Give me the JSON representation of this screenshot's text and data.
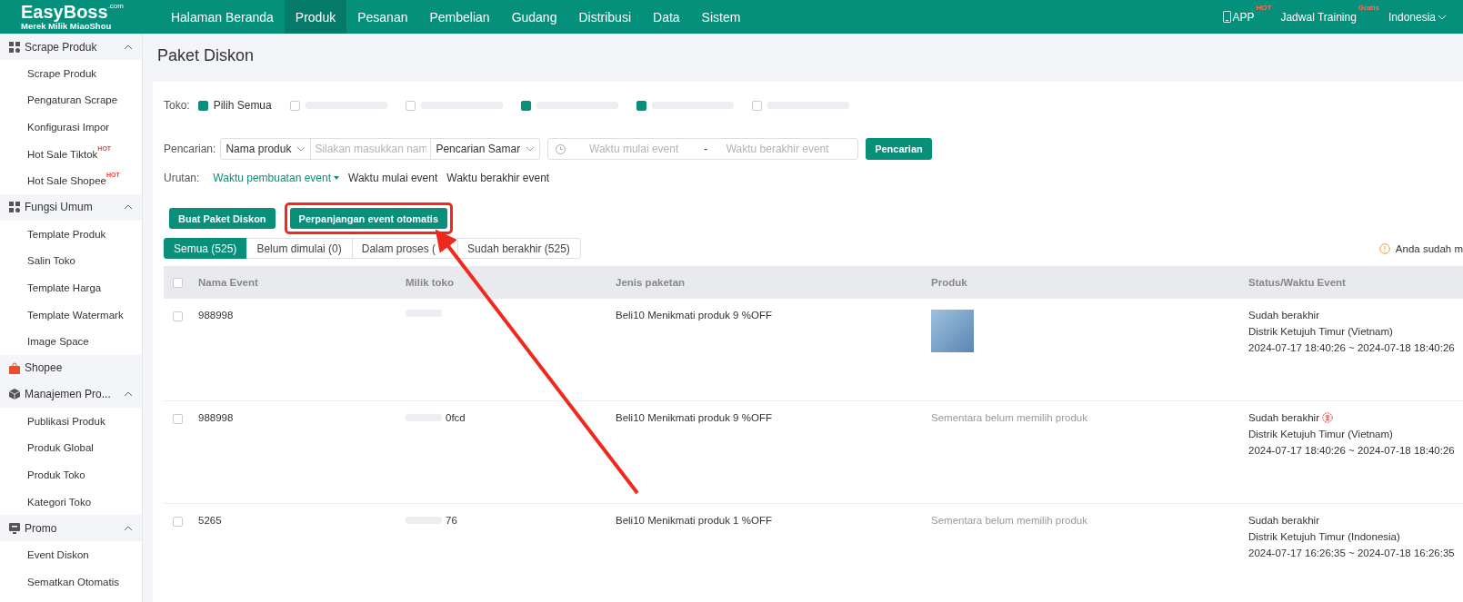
{
  "header": {
    "logo": "EasyBoss",
    "logo_suffix": ".com",
    "logo_tagline": "Merek Milik MiaoShou",
    "nav": [
      {
        "label": "Halaman Beranda",
        "selected": false
      },
      {
        "label": "Produk",
        "selected": true
      },
      {
        "label": "Pesanan",
        "selected": false
      },
      {
        "label": "Pembelian",
        "selected": false
      },
      {
        "label": "Gudang",
        "selected": false
      },
      {
        "label": "Distribusi",
        "selected": false
      },
      {
        "label": "Data",
        "selected": false
      },
      {
        "label": "Sistem",
        "selected": false
      }
    ],
    "right": [
      {
        "kind": "app",
        "label": "APP",
        "badge": "HOT"
      },
      {
        "kind": "link",
        "label": "Jadwal Training",
        "badge": "Gratis"
      },
      {
        "kind": "dropdown",
        "label": "Indonesia"
      }
    ]
  },
  "sidebar": {
    "groups": [
      {
        "title": "Scrape Produk",
        "expanded": true,
        "items": [
          {
            "label": "Scrape Produk"
          },
          {
            "label": "Pengaturan Scrape"
          },
          {
            "label": "Konfigurasi Impor"
          },
          {
            "label": "Hot Sale Tiktok",
            "badge": "HOT"
          },
          {
            "label": "Hot Sale Shopee",
            "badge": "HOT"
          }
        ]
      },
      {
        "title": "Fungsi Umum",
        "expanded": true,
        "items": [
          {
            "label": "Template Produk"
          },
          {
            "label": "Salin Toko"
          },
          {
            "label": "Template Harga"
          },
          {
            "label": "Template Watermark"
          },
          {
            "label": "Image Space"
          }
        ]
      },
      {
        "title": "Shopee",
        "expanded": false
      },
      {
        "title": "Manajemen Pro...",
        "expanded": true,
        "items": [
          {
            "label": "Publikasi Produk"
          },
          {
            "label": "Produk Global"
          },
          {
            "label": "Produk Toko"
          },
          {
            "label": "Kategori Toko"
          }
        ]
      },
      {
        "title": "Promo",
        "expanded": true,
        "items": [
          {
            "label": "Event Diskon"
          },
          {
            "label": "Sematkan Otomatis"
          }
        ]
      }
    ]
  },
  "page": {
    "title": "Paket Diskon",
    "shop_filter": {
      "label": "Toko:",
      "options": [
        {
          "label": "Pilih Semua",
          "checked": true
        },
        {
          "checked": false
        },
        {
          "checked": false
        },
        {
          "checked": true
        },
        {
          "checked": true
        },
        {
          "checked": false
        }
      ]
    },
    "search": {
      "label": "Pencarian:",
      "field_select": "Nama produk",
      "placeholder": "Silakan masukkan nam",
      "mode_select": "Pencarian Samar",
      "start_placeholder": "Waktu mulai event",
      "separator": "-",
      "end_placeholder": "Waktu berakhir event",
      "button": "Pencarian"
    },
    "sort": {
      "label": "Urutan:",
      "options": [
        {
          "label": "Waktu pembuatan event",
          "selected": true
        },
        {
          "label": "Waktu mulai event",
          "selected": false
        },
        {
          "label": "Waktu berakhir event",
          "selected": false
        }
      ]
    },
    "actions": [
      {
        "label": "Buat Paket Diskon",
        "highlighted": false
      },
      {
        "label": "Perpanjangan event otomatis",
        "highlighted": true
      }
    ],
    "tabs": [
      {
        "label": "Semua (525)",
        "selected": true
      },
      {
        "label": "Belum dimulai (0)",
        "selected": false
      },
      {
        "label": "Dalam proses (",
        "selected": false
      },
      {
        "label": "Sudah berakhir (525)",
        "selected": false
      }
    ],
    "notice": "Anda sudah m",
    "table": {
      "all_checked": false,
      "columns": [
        "Nama Event",
        "Milik toko",
        "Jenis paketan",
        "Produk",
        "Status/Waktu Event"
      ],
      "rows": [
        {
          "checked": false,
          "name": "988998",
          "shop": "",
          "package": "Beli10 Menikmati produk 9 %OFF",
          "product": {
            "kind": "image"
          },
          "status": "Sudah berakhir",
          "stamp": false,
          "region": "Distrik Ketujuh Timur (Vietnam)",
          "period": "2024-07-17 18:40:26 ~ 2024-07-18 18:40:26"
        },
        {
          "checked": false,
          "name": "988998",
          "shop": "0fcd",
          "package": "Beli10 Menikmati produk 9 %OFF",
          "product": {
            "kind": "text",
            "text": "Sementara belum memilih produk"
          },
          "status": "Sudah berakhir",
          "stamp": true,
          "region": "Distrik Ketujuh Timur (Vietnam)",
          "period": "2024-07-17 18:40:26 ~ 2024-07-18 18:40:26"
        },
        {
          "checked": false,
          "name": "5265",
          "shop": "76",
          "package": "Beli10 Menikmati produk 1 %OFF",
          "product": {
            "kind": "text",
            "text": "Sementara belum memilih produk"
          },
          "status": "Sudah berakhir",
          "stamp": false,
          "region": "Distrik Ketujuh Timur (Indonesia)",
          "period": "2024-07-17 16:26:35 ~ 2024-07-18 16:26:35"
        }
      ]
    }
  }
}
